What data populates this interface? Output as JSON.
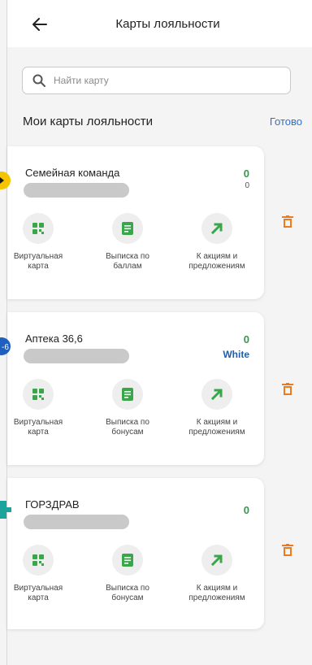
{
  "header": {
    "title": "Карты лояльности",
    "back_icon": "arrow-left-icon"
  },
  "search": {
    "placeholder": "Найти карту",
    "value": ""
  },
  "section": {
    "title": "Мои карты лояльности",
    "done_label": "Готово"
  },
  "colors": {
    "accent": "#2f6fcf",
    "points": "#2e9d48",
    "delete": "#f07a1a",
    "icon_green": "#3aa64a"
  },
  "cards": [
    {
      "name": "Семейная команда",
      "points": "0",
      "sub": "0",
      "actions": [
        {
          "label_1": "Виртуальная",
          "label_2": "карта"
        },
        {
          "label_1": "Выписка по",
          "label_2": "баллам"
        },
        {
          "label_1": "К акциям и",
          "label_2": "предложениям"
        }
      ]
    },
    {
      "name": "Аптека 36,6",
      "points": "0",
      "sub": "White",
      "logo_text": "-6",
      "actions": [
        {
          "label_1": "Виртуальная",
          "label_2": "карта"
        },
        {
          "label_1": "Выписка по",
          "label_2": "бонусам"
        },
        {
          "label_1": "К акциям и",
          "label_2": "предложениям"
        }
      ]
    },
    {
      "name": "ГОРЗДРАВ",
      "points": "0",
      "sub": "",
      "actions": [
        {
          "label_1": "Виртуальная",
          "label_2": "карта"
        },
        {
          "label_1": "Выписка по",
          "label_2": "бонусам"
        },
        {
          "label_1": "К акциям и",
          "label_2": "предложениям"
        }
      ]
    }
  ]
}
